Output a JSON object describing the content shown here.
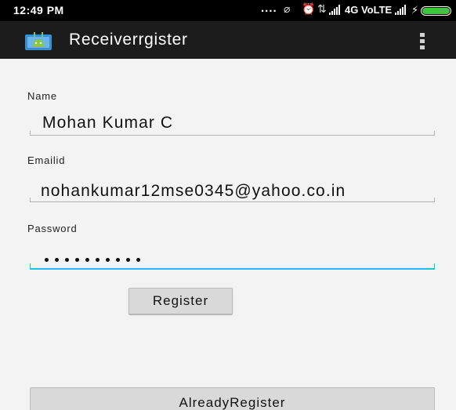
{
  "status_bar": {
    "time": "12:49 PM",
    "dots": "....",
    "network": "4G VoLTE"
  },
  "action_bar": {
    "title": "Receiverrgister",
    "app_icon": "android-app-icon",
    "overflow_icon": "overflow-menu-icon"
  },
  "form": {
    "name_label": "Name",
    "name_value": "Mohan Kumar C",
    "email_label": "Emailid",
    "email_value": "nohankumar12mse0345@yahoo.co.in",
    "password_label": "Password",
    "password_value": "••••••••••",
    "register_button": "Register",
    "already_button": "AlreadyRegister"
  },
  "colors": {
    "status_bar": "#000000",
    "action_bar": "#1c1c1c",
    "background": "#f3f3f3",
    "focus_accent": "#33b5e5",
    "button": "#d9d9d9",
    "battery": "#3ec43e"
  }
}
